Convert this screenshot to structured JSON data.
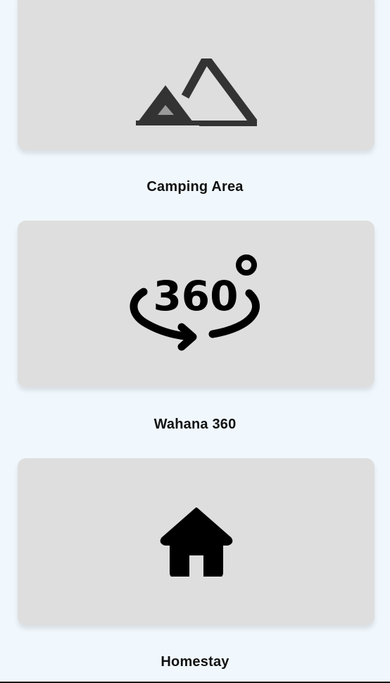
{
  "menu": {
    "items": [
      {
        "label": "Camping Area",
        "icon": "mountain-icon"
      },
      {
        "label": "Wahana 360",
        "icon": "rotate-360-icon",
        "icon_text": "360"
      },
      {
        "label": "Homestay",
        "icon": "house-icon"
      }
    ]
  },
  "colors": {
    "page_background": "#f1f8fd",
    "card_background": "#dedede",
    "icon_dark": "#333333",
    "icon_black": "#000000",
    "icon_grey_fill": "#9a9a9a",
    "label_text": "#111111"
  }
}
